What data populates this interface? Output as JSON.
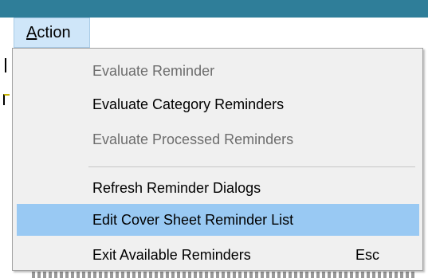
{
  "menubar": {
    "action_accel": "A",
    "action_rest": "ction"
  },
  "menu": {
    "items": [
      {
        "label": "Evaluate Reminder",
        "enabled": false
      },
      {
        "label": "Evaluate Category Reminders",
        "enabled": true
      },
      {
        "label": "Evaluate Processed Reminders",
        "enabled": false
      },
      {
        "label": "Refresh Reminder Dialogs",
        "enabled": true
      },
      {
        "label": "Edit Cover Sheet Reminder List",
        "enabled": true,
        "highlighted": true
      },
      {
        "label": "Exit Available Reminders",
        "enabled": true,
        "shortcut": "Esc"
      }
    ]
  },
  "colors": {
    "titlebar": "#2f7e99",
    "menu_background": "#f0f0f0",
    "highlight": "#99c9f3",
    "disabled_text": "#6d6d6d"
  }
}
